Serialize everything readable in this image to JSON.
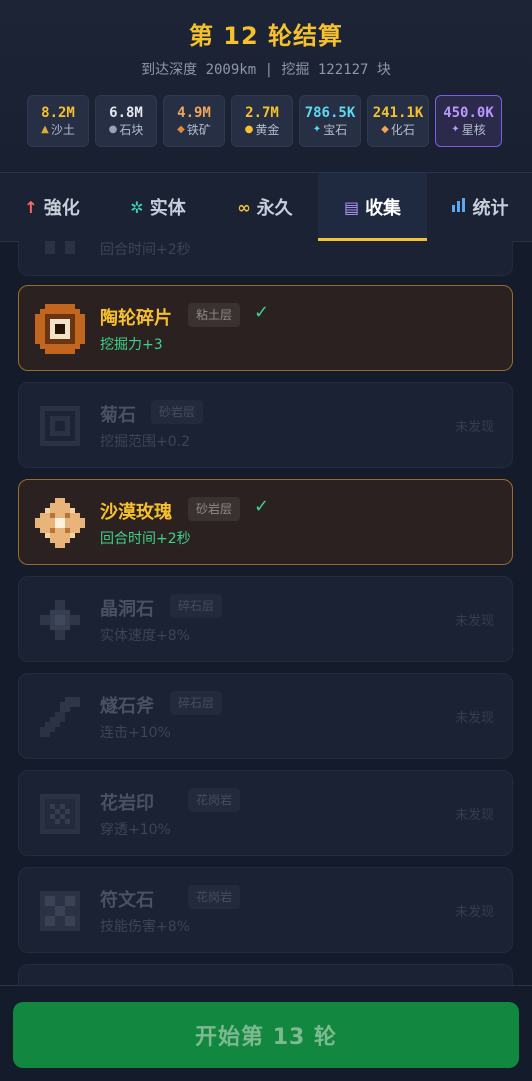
{
  "header": {
    "title": "第 12 轮结算",
    "subtitle": "到达深度 2009km | 挖掘 122127 块"
  },
  "resources": [
    {
      "value": "8.2M",
      "label": "沙土",
      "icon": "sand-icon",
      "color": "#f6c12d"
    },
    {
      "value": "6.8M",
      "label": "石块",
      "icon": "rock-icon",
      "color": "#e6e8ee"
    },
    {
      "value": "4.9M",
      "label": "铁矿",
      "icon": "iron-ore-icon",
      "color": "#f0a55a"
    },
    {
      "value": "2.7M",
      "label": "黄金",
      "icon": "gold-icon",
      "color": "#f6c12d"
    },
    {
      "value": "786.5K",
      "label": "宝石",
      "icon": "gem-icon",
      "color": "#5fd9f0"
    },
    {
      "value": "241.1K",
      "label": "化石",
      "icon": "fossil-icon",
      "color": "#f6c12d"
    },
    {
      "value": "450.0K",
      "label": "星核",
      "icon": "star-core-icon",
      "color": "#b897ff"
    }
  ],
  "tabs": [
    {
      "label": "強化",
      "icon": "arrow-up-icon"
    },
    {
      "label": "实体",
      "icon": "gear-icon"
    },
    {
      "label": "永久",
      "icon": "infinity-icon"
    },
    {
      "label": "收集",
      "icon": "list-icon",
      "active": true
    },
    {
      "label": "统计",
      "icon": "bar-chart-icon"
    }
  ],
  "collection": [
    {
      "name": "",
      "layer": "",
      "effect": "回合时间+2秒",
      "collected": false,
      "status": ""
    },
    {
      "name": "陶轮碎片",
      "layer": "粘土层",
      "effect": "挖掘力+3",
      "collected": true,
      "status": "",
      "check": "✓"
    },
    {
      "name": "菊石",
      "layer": "砂岩层",
      "effect": "挖掘范围+0.2",
      "collected": false,
      "status": "未发现"
    },
    {
      "name": "沙漠玫瑰",
      "layer": "砂岩层",
      "effect": "回合时间+2秒",
      "collected": true,
      "status": "",
      "check": "✓"
    },
    {
      "name": "晶洞石",
      "layer": "碎石层",
      "effect": "实体速度+8%",
      "collected": false,
      "status": "未发现"
    },
    {
      "name": "燧石斧",
      "layer": "碎石层",
      "effect": "连击+10%",
      "collected": false,
      "status": "未发现"
    },
    {
      "name": "花岩印",
      "layer": "花岗岩",
      "effect": "穿透+10%",
      "collected": false,
      "status": "未发现"
    },
    {
      "name": "符文石",
      "layer": "花岗岩",
      "effect": "技能伤害+8%",
      "collected": false,
      "status": "未发现"
    }
  ],
  "footer": {
    "start_button": "开始第 13 轮"
  }
}
